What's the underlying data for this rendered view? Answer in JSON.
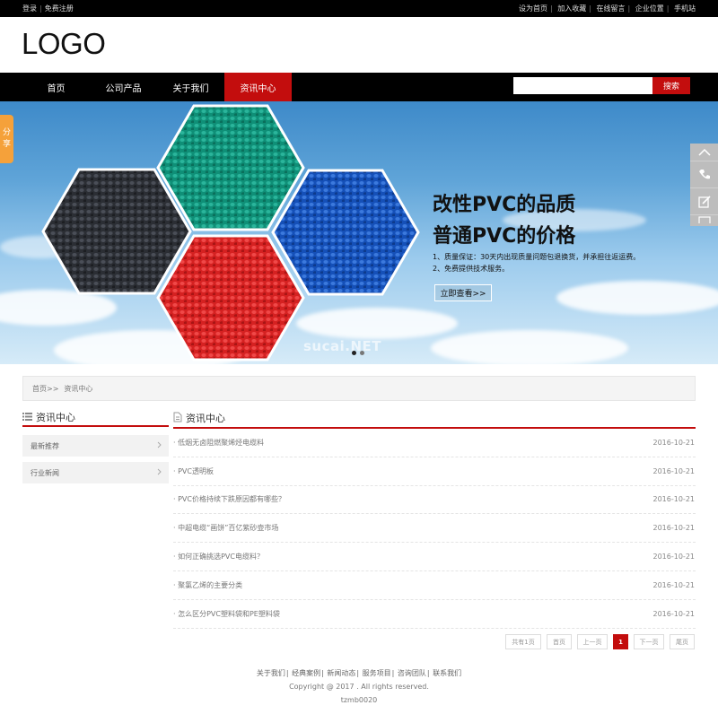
{
  "topbar": {
    "login": "登录",
    "register": "免费注册",
    "right_links": [
      "设为首页",
      "加入收藏",
      "在线留言",
      "企业位置",
      "手机站"
    ]
  },
  "header": {
    "logo": "LOGO"
  },
  "nav": {
    "items": [
      "首页",
      "公司产品",
      "关于我们",
      "资讯中心"
    ],
    "active_index": 3,
    "search_placeholder": "",
    "search_button": "搜索"
  },
  "banner": {
    "title_line1": "改性PVC的品质",
    "title_line2": "普通PVC的价格",
    "point1": "1、质量保证：30天内出现质量问题包退换货，并承担往返运费。",
    "point2": "2、免费提供技术服务。",
    "button": "立即查看>>",
    "watermark": "sucai.NET",
    "slides_total": 2,
    "slide_active": 1
  },
  "side_widgets": {
    "share": [
      "分",
      "享"
    ]
  },
  "breadcrumb": {
    "home": "首页",
    "sep": ">>",
    "current": "资讯中心"
  },
  "sidebar": {
    "title": "资讯中心",
    "items": [
      {
        "label": "最新推荐"
      },
      {
        "label": "行业新闻"
      }
    ]
  },
  "main": {
    "title": "资讯中心",
    "news": [
      {
        "title": "· 低烟无卤阻燃聚烯烃电缆料",
        "date": "2016-10-21"
      },
      {
        "title": "· PVC透明板",
        "date": "2016-10-21"
      },
      {
        "title": "· PVC价格持续下跌原因都有哪些？",
        "date": "2016-10-21"
      },
      {
        "title": "· 中超电缆“画饼”百亿紫砂壶市场",
        "date": "2016-10-21"
      },
      {
        "title": "· 如何正确挑选PVC电缆料？",
        "date": "2016-10-21"
      },
      {
        "title": "· 聚氯乙烯的主要分类",
        "date": "2016-10-21"
      },
      {
        "title": "· 怎么区分PVC塑料袋和PE塑料袋",
        "date": "2016-10-21"
      }
    ]
  },
  "pagination": {
    "total": "共有1页",
    "first": "首页",
    "prev": "上一页",
    "current": "1",
    "next": "下一页",
    "last": "尾页"
  },
  "footer": {
    "links": [
      "关于我们",
      "经典案例",
      "新闻动态",
      "服务项目",
      "咨询团队",
      "联系我们"
    ],
    "copyright": "Copyright @ 2017 . All rights reserved.",
    "code": "tzmb0020"
  },
  "colors": {
    "accent": "#c30d0d",
    "topbar": "#000000",
    "share_tab": "#f5a13a"
  }
}
